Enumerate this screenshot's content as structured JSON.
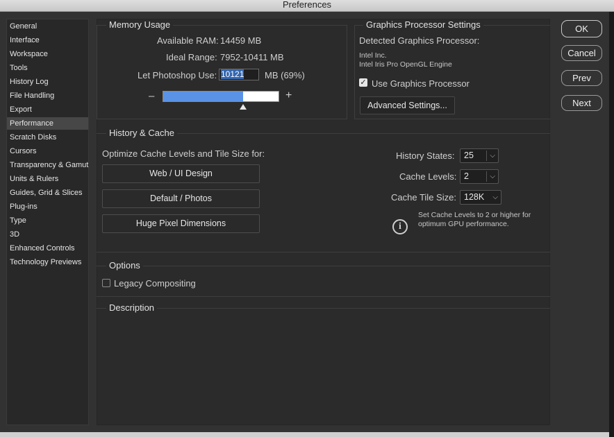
{
  "window": {
    "title": "Preferences"
  },
  "sidebar": {
    "items": [
      {
        "label": "General"
      },
      {
        "label": "Interface"
      },
      {
        "label": "Workspace"
      },
      {
        "label": "Tools"
      },
      {
        "label": "History Log"
      },
      {
        "label": "File Handling"
      },
      {
        "label": "Export"
      },
      {
        "label": "Performance",
        "selected": true
      },
      {
        "label": "Scratch Disks"
      },
      {
        "label": "Cursors"
      },
      {
        "label": "Transparency & Gamut"
      },
      {
        "label": "Units & Rulers"
      },
      {
        "label": "Guides, Grid & Slices"
      },
      {
        "label": "Plug-ins"
      },
      {
        "label": "Type"
      },
      {
        "label": "3D"
      },
      {
        "label": "Enhanced Controls"
      },
      {
        "label": "Technology Previews"
      }
    ]
  },
  "memory": {
    "heading": "Memory Usage",
    "available_label": "Available RAM:",
    "available_value": "14459 MB",
    "ideal_label": "Ideal Range:",
    "ideal_value": "7952-10411 MB",
    "let_use_label": "Let Photoshop Use:",
    "let_use_value": "10121",
    "let_use_suffix": "MB (69%)",
    "minus": "–",
    "plus": "+",
    "slider_fraction": 0.69
  },
  "gpu": {
    "heading": "Graphics Processor Settings",
    "detected_label": "Detected Graphics Processor:",
    "vendor": "Intel Inc.",
    "renderer": "Intel Iris Pro OpenGL Engine",
    "use_gpu_label": "Use Graphics Processor",
    "use_gpu_checked": true,
    "advanced_label": "Advanced Settings..."
  },
  "history_cache": {
    "heading": "History & Cache",
    "optimize_label": "Optimize Cache Levels and Tile Size for:",
    "presets": [
      "Web / UI Design",
      "Default / Photos",
      "Huge Pixel Dimensions"
    ],
    "history_states_label": "History States:",
    "history_states_value": "25",
    "cache_levels_label": "Cache Levels:",
    "cache_levels_value": "2",
    "tile_size_label": "Cache Tile Size:",
    "tile_size_value": "128K",
    "info_line1": "Set Cache Levels to 2 or higher for",
    "info_line2": "optimum GPU performance."
  },
  "options": {
    "heading": "Options",
    "legacy_label": "Legacy Compositing",
    "legacy_checked": false
  },
  "description": {
    "heading": "Description"
  },
  "buttons": {
    "ok": "OK",
    "cancel": "Cancel",
    "prev": "Prev",
    "next": "Next"
  }
}
